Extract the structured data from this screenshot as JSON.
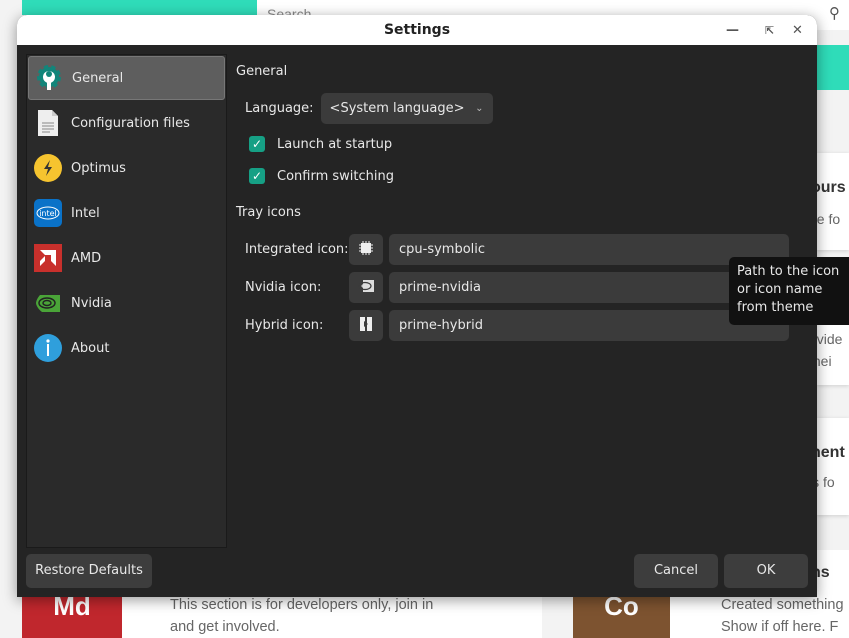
{
  "background": {
    "search_placeholder": "Search",
    "cards": [
      {
        "title": "ours",
        "text": "ne fo"
      },
      {
        "text1": "ovide",
        "text2": " thei"
      },
      {
        "title": "nent",
        "text": " is fo"
      },
      {
        "title": "ns"
      }
    ],
    "bottom_left": {
      "badge": "Md",
      "line1": "This section is for developers only, join in",
      "line2": "and get involved."
    },
    "bottom_right": {
      "badge": "Co",
      "line1": "Created something",
      "line2": "Show if off here. F"
    }
  },
  "dialog": {
    "title": "Settings",
    "sidebar": [
      {
        "label": "General",
        "icon": "settings-wrench-icon",
        "selected": true
      },
      {
        "label": "Configuration files",
        "icon": "document-icon"
      },
      {
        "label": "Optimus",
        "icon": "lightning-icon"
      },
      {
        "label": "Intel",
        "icon": "intel-icon"
      },
      {
        "label": "AMD",
        "icon": "amd-icon"
      },
      {
        "label": "Nvidia",
        "icon": "nvidia-icon"
      },
      {
        "label": "About",
        "icon": "info-icon"
      }
    ],
    "general": {
      "heading": "General",
      "language_label": "Language:",
      "language_value": "<System language>",
      "launch_at_startup": {
        "label": "Launch at startup",
        "checked": true
      },
      "confirm_switching": {
        "label": "Confirm switching",
        "checked": true
      }
    },
    "tray": {
      "heading": "Tray icons",
      "integrated": {
        "label": "Integrated icon:",
        "value": "cpu-symbolic"
      },
      "nvidia": {
        "label": "Nvidia icon:",
        "value": "prime-nvidia"
      },
      "hybrid": {
        "label": "Hybrid icon:",
        "value": "prime-hybrid"
      }
    },
    "tooltip": "Path to the icon or icon name from theme",
    "buttons": {
      "restore": "Restore Defaults",
      "cancel": "Cancel",
      "ok": "OK"
    },
    "accent": "#16a085"
  }
}
